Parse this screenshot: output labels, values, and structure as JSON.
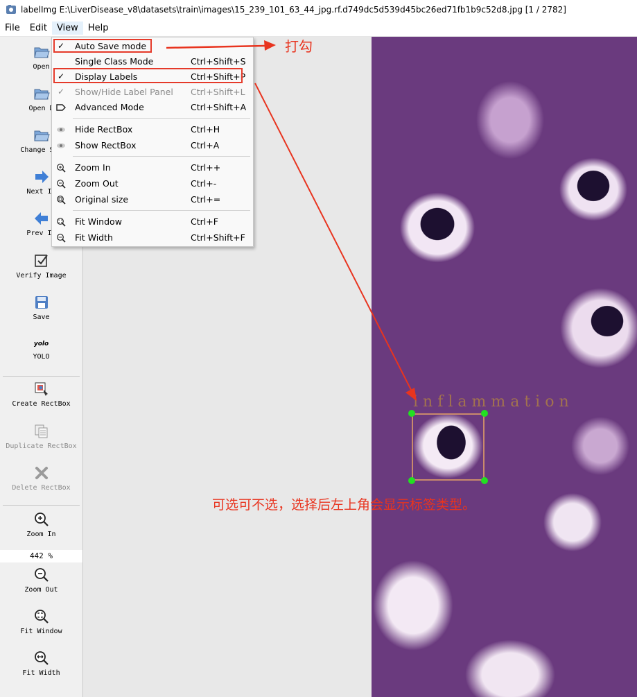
{
  "window": {
    "title": "labelImg E:\\LiverDisease_v8\\datasets\\train\\images\\15_239_101_63_44_jpg.rf.d749dc5d539d45bc26ed71fb1b9c52d8.jpg [1 / 2782]"
  },
  "menubar": [
    "File",
    "Edit",
    "View",
    "Help"
  ],
  "toolbar": {
    "open": "Open",
    "open_dir": "Open D",
    "change_save": "Change Sav",
    "next_image": "Next Im",
    "prev_image": "Prev Im",
    "verify_image": "Verify Image",
    "save": "Save",
    "yolo_icon_text": "yolo",
    "yolo": "YOLO",
    "create_rectbox": "Create RectBox",
    "duplicate_rectbox": "Duplicate RectBox",
    "delete_rectbox": "Delete RectBox",
    "zoom_in": "Zoom In",
    "zoom_value": "442 %",
    "zoom_out": "Zoom Out",
    "fit_window": "Fit Window",
    "fit_width": "Fit Width"
  },
  "view_menu": {
    "items": [
      {
        "label": "Auto Save mode",
        "shortcut": "",
        "checked": true,
        "enabled": true,
        "icon": "check"
      },
      {
        "label": "Single Class Mode",
        "shortcut": "Ctrl+Shift+S",
        "checked": false,
        "enabled": true,
        "icon": ""
      },
      {
        "label": "Display Labels",
        "shortcut": "Ctrl+Shift+P",
        "checked": true,
        "enabled": true,
        "icon": "check"
      },
      {
        "label": "Show/Hide Label Panel",
        "shortcut": "Ctrl+Shift+L",
        "checked": true,
        "enabled": false,
        "icon": "check"
      },
      {
        "label": "Advanced Mode",
        "shortcut": "Ctrl+Shift+A",
        "checked": false,
        "enabled": true,
        "icon": "tag-icon"
      },
      {
        "label": "Hide RectBox",
        "shortcut": "Ctrl+H",
        "checked": false,
        "enabled": true,
        "icon": "eye-icon"
      },
      {
        "label": "Show RectBox",
        "shortcut": "Ctrl+A",
        "checked": false,
        "enabled": true,
        "icon": "eye-icon"
      },
      {
        "label": "Zoom In",
        "shortcut": "Ctrl++",
        "checked": false,
        "enabled": true,
        "icon": "zoom-in-icon"
      },
      {
        "label": "Zoom Out",
        "shortcut": "Ctrl+-",
        "checked": false,
        "enabled": true,
        "icon": "zoom-out-icon"
      },
      {
        "label": "Original size",
        "shortcut": "Ctrl+=",
        "checked": false,
        "enabled": true,
        "icon": "zoom-original-icon"
      },
      {
        "label": "Fit Window",
        "shortcut": "Ctrl+F",
        "checked": false,
        "enabled": true,
        "icon": "fit-window-icon"
      },
      {
        "label": "Fit Width",
        "shortcut": "Ctrl+Shift+F",
        "checked": false,
        "enabled": true,
        "icon": "fit-width-icon"
      }
    ]
  },
  "canvas": {
    "box_label": "inflammation"
  },
  "annotations": {
    "check_note": "打勾",
    "optional_note": "可选可不选，选择后左上角会显示标签类型。",
    "accent_color": "#e8341f"
  }
}
